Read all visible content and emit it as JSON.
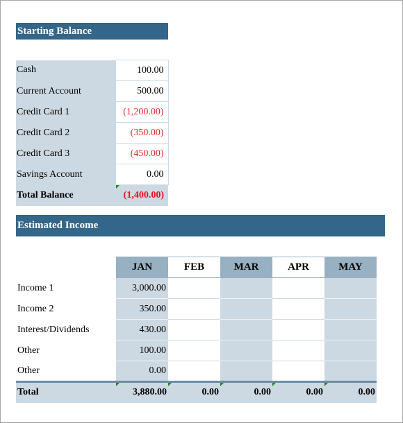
{
  "starting_balance": {
    "title": "Starting Balance",
    "rows": [
      {
        "label": "Cash",
        "value": "100.00",
        "negative": false
      },
      {
        "label": "Current Account",
        "value": "500.00",
        "negative": false
      },
      {
        "label": "Credit Card 1",
        "value": "(1,200.00)",
        "negative": true
      },
      {
        "label": "Credit Card 2",
        "value": "(350.00)",
        "negative": true
      },
      {
        "label": "Credit Card 3",
        "value": "(450.00)",
        "negative": true
      },
      {
        "label": "Savings Account",
        "value": "0.00",
        "negative": false
      }
    ],
    "total": {
      "label": "Total Balance",
      "value": "(1,400.00)"
    }
  },
  "estimated_income": {
    "title": "Estimated Income",
    "months": [
      "JAN",
      "FEB",
      "MAR",
      "APR",
      "MAY"
    ],
    "rows": [
      {
        "label": "Income 1",
        "values": [
          "3,000.00",
          "",
          "",
          "",
          ""
        ]
      },
      {
        "label": "Income 2",
        "values": [
          "350.00",
          "",
          "",
          "",
          ""
        ]
      },
      {
        "label": "Interest/Dividends",
        "values": [
          "430.00",
          "",
          "",
          "",
          ""
        ]
      },
      {
        "label": "Other",
        "values": [
          "100.00",
          "",
          "",
          "",
          ""
        ]
      },
      {
        "label": "Other",
        "values": [
          "0.00",
          "",
          "",
          "",
          ""
        ]
      }
    ],
    "total": {
      "label": "Total",
      "values": [
        "3,880.00",
        "0.00",
        "0.00",
        "0.00",
        "0.00"
      ]
    }
  },
  "colors": {
    "header_bg": "#336688",
    "label_bg": "#cdd9e2",
    "month_header_bg": "#97b0c2",
    "negative_text": "#e8262a",
    "comment_marker": "#1a8a1a"
  }
}
